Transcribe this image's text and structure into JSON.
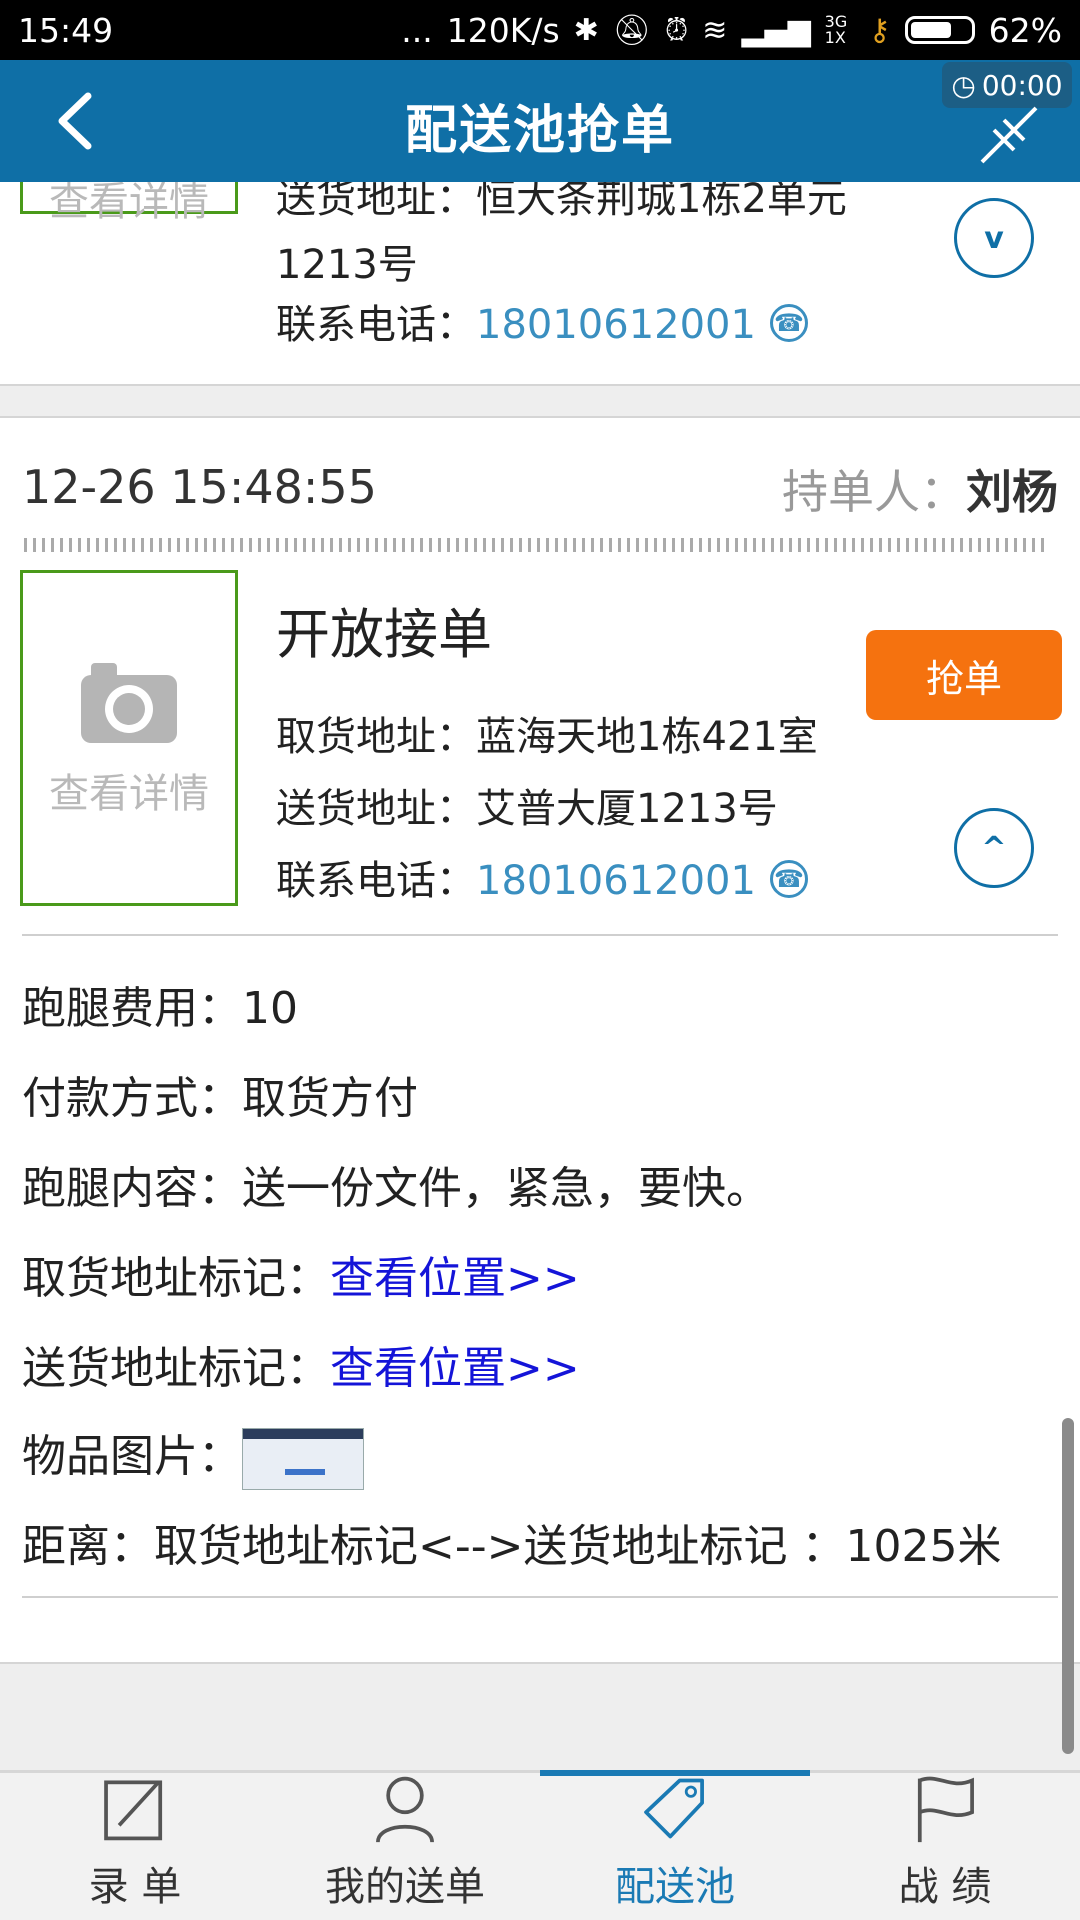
{
  "status_bar": {
    "time": "15:49",
    "dots": "...",
    "speed": "120K/s",
    "network": "3G 1X",
    "battery": "62%"
  },
  "header": {
    "title": "配送池抢单",
    "timer": "00:00"
  },
  "prev_card": {
    "delivery_address_label": "送货地址：",
    "delivery_address_line1": "恒大条荆城1栋2单元",
    "delivery_address_line2": "1213号",
    "phone_label": "联系电话：",
    "phone": "18010612001",
    "thumb_text": "查看详情",
    "expand_icon": "v"
  },
  "order": {
    "timestamp": "12-26 15:48:55",
    "holder_label": "持单人：",
    "holder_name": "刘杨",
    "thumb_text": "查看详情",
    "status": "开放接单",
    "grab_label": "抢单",
    "pickup_label": "取货地址：",
    "pickup_address": "蓝海天地1栋421室",
    "delivery_label": "送货地址：",
    "delivery_address": "艾普大厦1213号",
    "phone_label": "联系电话：",
    "phone": "18010612001",
    "collapse_icon": "^",
    "details": {
      "fee_label": "跑腿费用：",
      "fee": "10",
      "payment_label": "付款方式：",
      "payment": "取货方付",
      "content_label": "跑腿内容：",
      "content": "送一份文件，紧急，要快。",
      "pickup_mark_label": "取货地址标记：",
      "pickup_mark_link": "查看位置>>",
      "delivery_mark_label": "送货地址标记：",
      "delivery_mark_link": "查看位置>>",
      "photo_label": "物品图片：",
      "distance_text": "距离：取货地址标记<-->送货地址标记 ：1025米"
    }
  },
  "tabs": [
    {
      "label": "录 单",
      "icon": "edit-icon"
    },
    {
      "label": "我的送单",
      "icon": "user-icon"
    },
    {
      "label": "配送池",
      "icon": "tag-icon",
      "active": true
    },
    {
      "label": "战 绩",
      "icon": "flag-icon"
    }
  ],
  "colors": {
    "header": "#0f6fa6",
    "grab_button": "#f5720f",
    "active_tab": "#1a7ab4",
    "link": "#1414d8",
    "phone": "#3a8fc0"
  }
}
